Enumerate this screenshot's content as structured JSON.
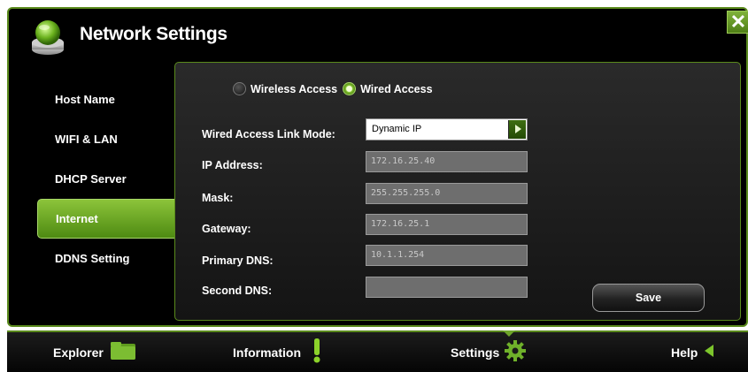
{
  "window": {
    "title": "Network Settings",
    "close_label": "✕"
  },
  "sidebar": {
    "items": [
      {
        "label": "Host Name",
        "active": false
      },
      {
        "label": "WIFI & LAN",
        "active": false
      },
      {
        "label": "DHCP Server",
        "active": false
      },
      {
        "label": "Internet",
        "active": true
      },
      {
        "label": "DDNS Setting",
        "active": false
      }
    ]
  },
  "access_mode": {
    "options": [
      {
        "label": "Wireless Access",
        "selected": false
      },
      {
        "label": "Wired Access",
        "selected": true
      }
    ]
  },
  "form": {
    "link_mode": {
      "label": "Wired Access Link Mode:",
      "value": "Dynamic IP"
    },
    "ip_address": {
      "label": "IP Address:",
      "value": "172.16.25.40"
    },
    "mask": {
      "label": "Mask:",
      "value": "255.255.255.0"
    },
    "gateway": {
      "label": "Gateway:",
      "value": "172.16.25.1"
    },
    "primary_dns": {
      "label": "Primary DNS:",
      "value": "10.1.1.254"
    },
    "second_dns": {
      "label": "Second DNS:",
      "value": ""
    }
  },
  "buttons": {
    "save_label": "Save"
  },
  "taskbar": {
    "tabs": [
      {
        "label": "Explorer",
        "icon": "folder-icon"
      },
      {
        "label": "Information",
        "icon": "exclamation-icon"
      },
      {
        "label": "Settings",
        "icon": "gear-icon",
        "active": true
      },
      {
        "label": "Help",
        "icon": "arrow-left-icon"
      }
    ]
  },
  "colors": {
    "accent": "#6ea52a",
    "background": "#000000",
    "text": "#ffffff"
  }
}
